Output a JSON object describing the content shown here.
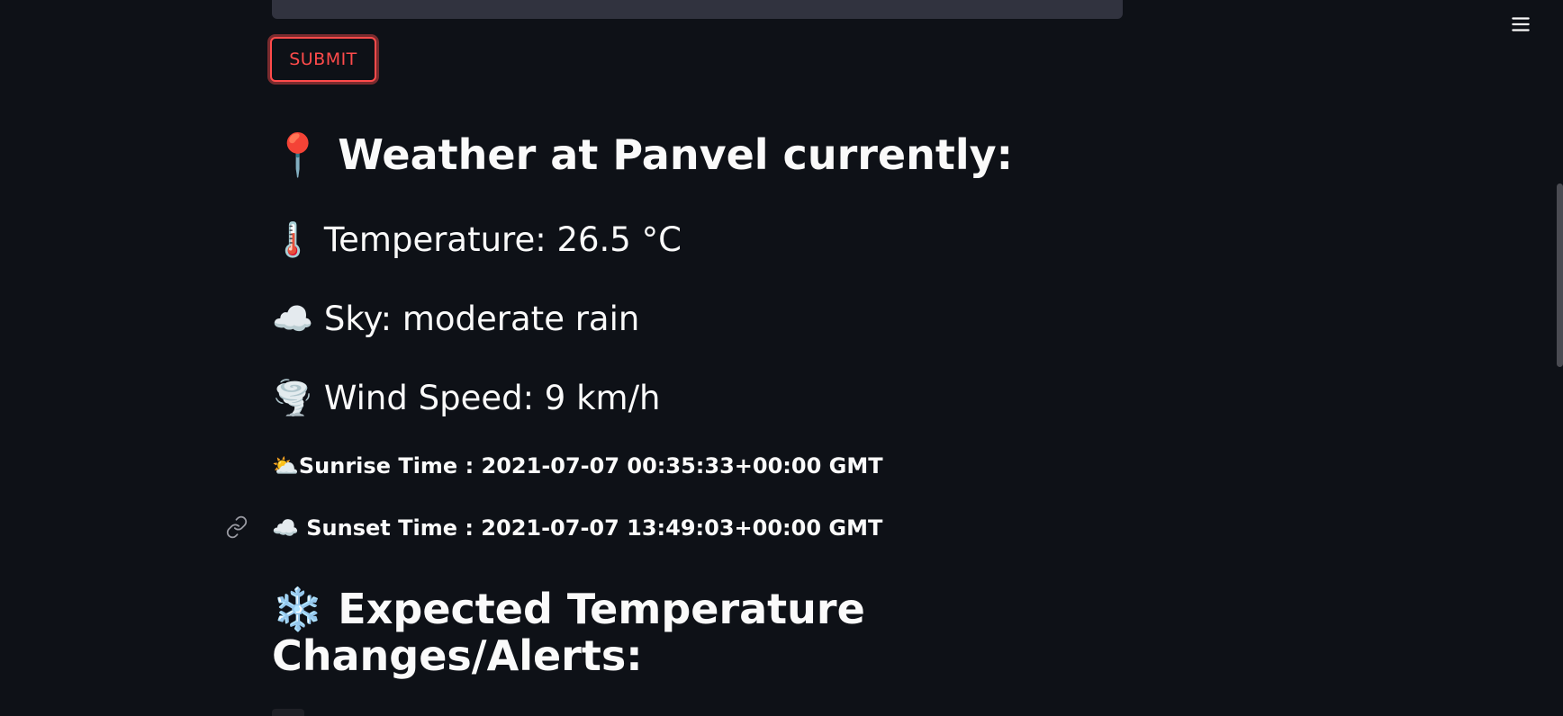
{
  "form": {
    "submit_label": "SUBMIT"
  },
  "weather": {
    "heading_icon": "📍",
    "heading": "Weather at Panvel currently:",
    "temperature_icon": "🌡️",
    "temperature": "Temperature: 26.5 °C",
    "sky_icon": "☁️",
    "sky": "Sky: moderate rain",
    "wind_icon": "🌪️",
    "wind": "Wind Speed: 9 km/h",
    "sunrise_icon": "⛅",
    "sunrise": "Sunrise Time : 2021-07-07 00:35:33+00:00 GMT",
    "sunset_icon": "☁️",
    "sunset": "Sunset Time : 2021-07-07 13:49:03+00:00 GMT"
  },
  "alerts": {
    "heading_icon": "❄️",
    "heading": "Expected Temperature Changes/Alerts:"
  },
  "colors": {
    "background": "#0e1117",
    "accent": "#ff4b4b",
    "input_bg": "#31333f",
    "text": "#fafafa"
  },
  "icons": {
    "menu": "hamburger-menu-icon",
    "anchor": "link-icon"
  }
}
